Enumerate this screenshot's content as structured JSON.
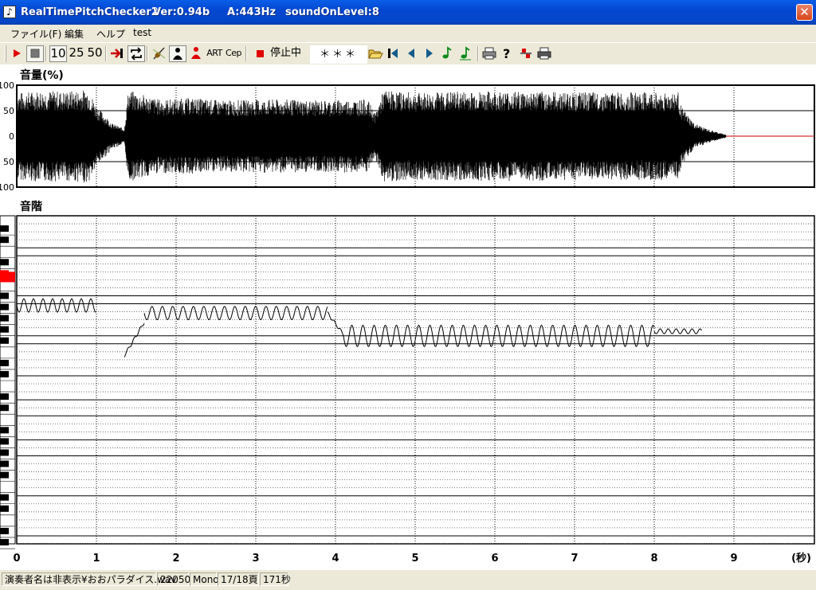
{
  "window": {
    "app_name": "RealTimePitchChecker2",
    "version": "Ver:0.94b",
    "a_freq": "A:443Hz",
    "sound_on_level": "soundOnLevel:8",
    "close_label": "✕"
  },
  "menu": [
    "ファイル(F)",
    "編集",
    "ヘルプ",
    "test"
  ],
  "toolbar": {
    "zoom_10": "10",
    "zoom_25": "25",
    "zoom_50": "50",
    "art_label": "ART",
    "cep_label": "Cep",
    "status_text": "停止中",
    "note_display": "＊＊＊"
  },
  "icons": {
    "play": "play-icon",
    "stop": "stop-icon",
    "jump_end": "jump-end-icon",
    "loop": "loop-icon",
    "violin": "violin-icon",
    "singer": "singer-icon",
    "singer_red": "singer-red-icon",
    "record_stop": "record-stop-icon",
    "open": "open-folder-icon",
    "first": "first-icon",
    "prev": "prev-icon",
    "next": "next-icon",
    "note_a": "note-icon",
    "note_b": "note-alt-icon",
    "print": "print-icon",
    "help": "help-icon",
    "marker": "marker-icon",
    "print2": "print2-icon"
  },
  "volume_panel": {
    "title": "音量(%)",
    "y_ticks": [
      "100",
      "50",
      "0",
      "50",
      "100"
    ]
  },
  "pitch_panel": {
    "title": "音階"
  },
  "time_axis": {
    "ticks": [
      "0",
      "1",
      "2",
      "3",
      "4",
      "5",
      "6",
      "7",
      "8",
      "9"
    ],
    "unit": "(秒)"
  },
  "status": {
    "file": "演奏者名は非表示¥おおパラダイス.wav",
    "rate": "22050",
    "channels": "Mono",
    "page": "17/18頁",
    "duration": "171秒"
  },
  "colors": {
    "title_bar": "#0347d1",
    "waveform": "#000000",
    "highlight_key": "#ff0000",
    "zero_line_tail": "#cc0000"
  },
  "chart_data": [
    {
      "type": "area",
      "title": "音量(%)",
      "x_unit": "秒",
      "xlim": [
        0,
        10
      ],
      "ylim": [
        -100,
        100
      ],
      "envelope": [
        [
          0.0,
          85
        ],
        [
          0.3,
          90
        ],
        [
          0.6,
          88
        ],
        [
          0.9,
          92
        ],
        [
          1.0,
          60
        ],
        [
          1.2,
          25
        ],
        [
          1.35,
          15
        ],
        [
          1.4,
          90
        ],
        [
          1.8,
          72
        ],
        [
          2.2,
          75
        ],
        [
          2.6,
          70
        ],
        [
          3.0,
          72
        ],
        [
          3.4,
          72
        ],
        [
          3.8,
          70
        ],
        [
          4.2,
          72
        ],
        [
          4.4,
          72
        ],
        [
          4.5,
          45
        ],
        [
          4.6,
          90
        ],
        [
          5.0,
          85
        ],
        [
          5.5,
          88
        ],
        [
          6.0,
          88
        ],
        [
          6.5,
          88
        ],
        [
          7.0,
          86
        ],
        [
          7.5,
          86
        ],
        [
          8.0,
          86
        ],
        [
          8.3,
          86
        ],
        [
          8.35,
          55
        ],
        [
          8.5,
          25
        ],
        [
          8.7,
          12
        ],
        [
          8.9,
          3
        ]
      ]
    },
    {
      "type": "line",
      "title": "音階",
      "x_unit": "秒",
      "xlim": [
        0,
        10
      ],
      "segments": [
        {
          "start": 0.0,
          "end": 1.0,
          "center": 2.35,
          "amp": 0.22,
          "period": 0.12
        },
        {
          "start": 1.35,
          "end": 1.6,
          "ramp_from": 4.0,
          "ramp_to": 2.9
        },
        {
          "start": 1.6,
          "end": 3.9,
          "center": 2.6,
          "amp": 0.22,
          "period": 0.13
        },
        {
          "start": 3.9,
          "end": 4.1,
          "ramp_from": 2.6,
          "ramp_to": 3.3
        },
        {
          "start": 4.1,
          "end": 8.0,
          "center": 3.35,
          "amp": 0.35,
          "period": 0.14
        },
        {
          "start": 8.0,
          "end": 8.6,
          "center": 3.2,
          "amp": 0.08,
          "period": 0.1
        }
      ]
    }
  ]
}
